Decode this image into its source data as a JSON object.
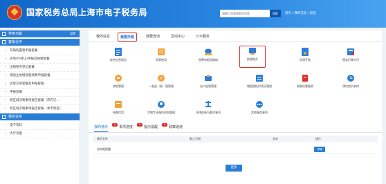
{
  "header": {
    "title": "国家税务总局上海市电子税务局",
    "search_placeholder": "请输入您要搜索的内容",
    "search_btn": "搜索",
    "links": "首页  |  我的信息  |  退出"
  },
  "sidebar": {
    "sections": [
      {
        "title": "常用功能",
        "more": "设置",
        "items": []
      },
      {
        "title": "套餐业务",
        "items": [
          "车辆购置税申报套餐",
          "房地产(转让)申报及纳税套餐",
          "注销税务登记套餐",
          "增值土地增值税清算申报套餐",
          "房屋交易套餐及申报套餐",
          "申报套餐",
          "跨区域涉税事项报告套餐（市内迁…",
          "跨区域涉税事项报告套餐（本市跨区）"
        ]
      },
      {
        "title": "我的业务",
        "items": [
          "电子资料",
          "大厅流量"
        ]
      }
    ]
  },
  "tabs": [
    {
      "label": "我的信息"
    },
    {
      "label": "我要办税"
    },
    {
      "label": "我要查询"
    },
    {
      "label": "互动中心"
    },
    {
      "label": "公众服务"
    }
  ],
  "icons": [
    {
      "label": "综合信息报告",
      "icon": "report-icon"
    },
    {
      "label": "发票使用",
      "icon": "invoice-icon"
    },
    {
      "label": "税费申报及缴纳",
      "icon": "tax-declare-icon"
    },
    {
      "label": "即收即办",
      "icon": "instant-icon"
    },
    {
      "label": "证明开具",
      "icon": "certificate-icon"
    },
    {
      "label": "税务行政许可",
      "icon": "permit-icon"
    },
    {
      "label": "核定管理",
      "icon": "verify-icon"
    },
    {
      "label": "一般退（抵）税管理",
      "icon": "refund-icon"
    },
    {
      "label": "出口退税管理",
      "icon": "export-refund-icon"
    },
    {
      "label": "增值税抵扣凭证管理",
      "icon": "deduction-icon"
    },
    {
      "label": "税收优惠备案",
      "icon": "preferential-icon"
    },
    {
      "label": "预约定价安排",
      "icon": "pricing-icon"
    },
    {
      "label": "纳税信用",
      "icon": "credit-icon"
    },
    {
      "label": "涉税专业服务机构管理",
      "icon": "agency-icon"
    },
    {
      "label": "法律追责与救济事项",
      "icon": "legal-icon"
    },
    {
      "label": "其他服务事项",
      "icon": "other-icon"
    }
  ],
  "lower_tabs": [
    {
      "label": "我的待办",
      "badge": "0"
    },
    {
      "label": "事项进度",
      "badge": "5"
    },
    {
      "label": "提示提醒",
      "badge": "0"
    },
    {
      "label": "政策速递",
      "badge": ""
    }
  ],
  "table": {
    "headers": [
      "事项名称",
      "截止日期",
      "状态",
      "操作"
    ],
    "rows": [
      {
        "name": "应申报提醒",
        "deadline": "",
        "status": "",
        "action": "详情"
      }
    ]
  },
  "more_btn": "更多",
  "colors": {
    "primary": "#2b7ed6",
    "highlight": "#e0302a"
  }
}
